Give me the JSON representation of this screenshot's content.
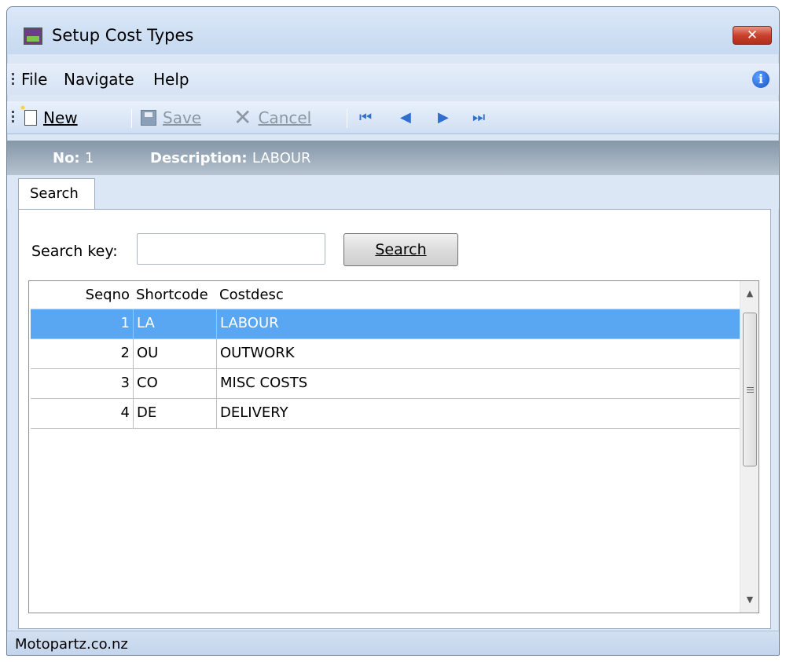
{
  "window": {
    "title": "Setup Cost Types",
    "close_label": "✕"
  },
  "menu": {
    "items": [
      "File",
      "Navigate",
      "Help"
    ]
  },
  "toolbar": {
    "new_label": "New",
    "save_label": "Save",
    "cancel_label": "Cancel",
    "nav": {
      "first": "⏮",
      "prev": "◀",
      "next": "▶",
      "last": "⏭"
    }
  },
  "record": {
    "no_label": "No:",
    "no_value": "1",
    "desc_label": "Description:",
    "desc_value": "LABOUR"
  },
  "tabs": [
    {
      "label": "Search"
    }
  ],
  "search": {
    "key_label": "Search key:",
    "key_value": "",
    "button_label": "Search"
  },
  "grid": {
    "columns": [
      "Seqno",
      "Shortcode",
      "Costdesc"
    ],
    "rows": [
      {
        "seqno": "1",
        "shortcode": "LA",
        "costdesc": "LABOUR",
        "selected": true
      },
      {
        "seqno": "2",
        "shortcode": "OU",
        "costdesc": "OUTWORK",
        "selected": false
      },
      {
        "seqno": "3",
        "shortcode": "CO",
        "costdesc": "MISC COSTS",
        "selected": false
      },
      {
        "seqno": "4",
        "shortcode": "DE",
        "costdesc": "DELIVERY",
        "selected": false
      }
    ]
  },
  "status": {
    "text": "Motopartz.co.nz"
  },
  "colors": {
    "selection": "#59a7f3",
    "close": "#c8422c"
  }
}
